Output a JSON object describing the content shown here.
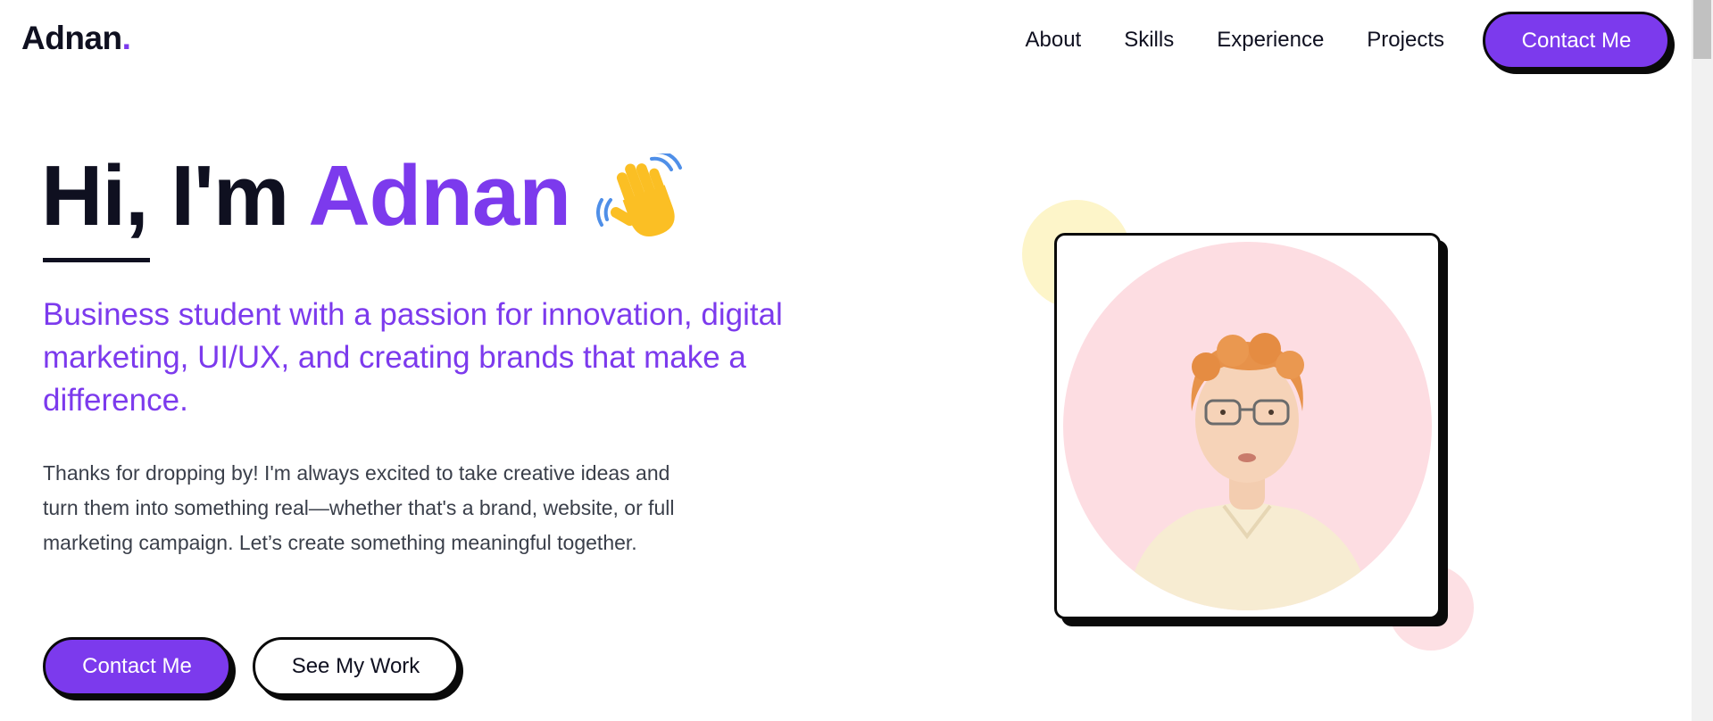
{
  "header": {
    "logo_text": "Adnan",
    "logo_dot": ".",
    "nav": [
      {
        "label": "About"
      },
      {
        "label": "Skills"
      },
      {
        "label": "Experience"
      },
      {
        "label": "Projects"
      }
    ],
    "cta_label": "Contact Me"
  },
  "hero": {
    "greeting": "Hi, I'm ",
    "name": "Adnan",
    "wave_icon": "waving-hand-icon",
    "tagline": "Business student with a passion for innovation, digital marketing, UI/UX, and creating brands that make a difference.",
    "intro": "Thanks for dropping by! I'm always excited to take creative ideas and turn them into something real—whether that's a brand, website, or full marketing campaign. Let’s create something meaningful together.",
    "primary_button": "Contact Me",
    "secondary_button": "See My Work"
  },
  "colors": {
    "accent": "#7c3aed",
    "text": "#0f1020",
    "body_text": "#3a3f4a",
    "portrait_bg": "#fddde2",
    "blob_yellow": "#fdf5c9",
    "blob_pink": "#fde0e4"
  }
}
